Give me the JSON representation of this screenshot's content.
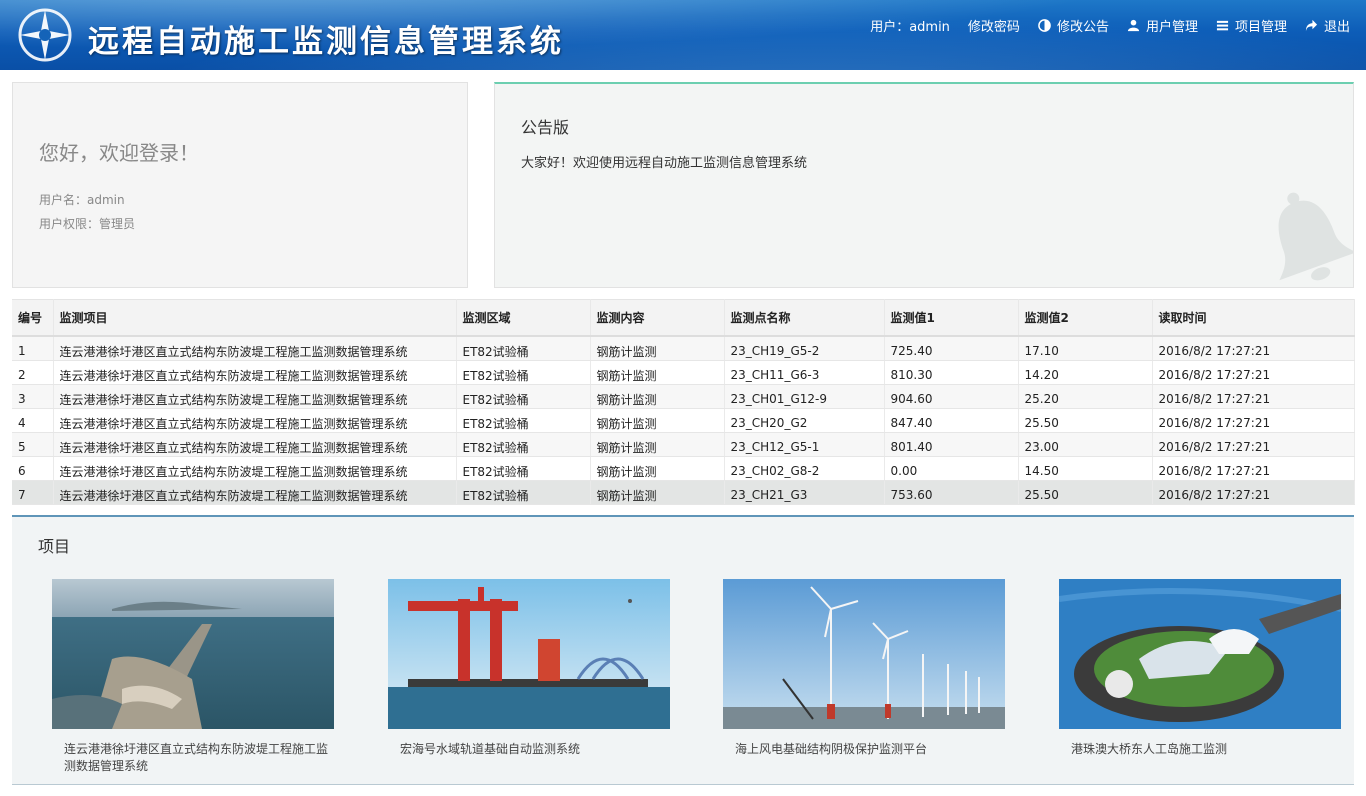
{
  "header": {
    "title": "远程自动施工监测信息管理系统",
    "nav": {
      "user": "用户：admin",
      "change_password": "修改密码",
      "edit_notice": "修改公告",
      "user_manage": "用户管理",
      "project_manage": "项目管理",
      "logout": "退出"
    }
  },
  "welcome": {
    "greeting": "您好，欢迎登录！",
    "username": "用户名：admin",
    "role": "用户权限：管理员"
  },
  "notice": {
    "title": "公告版",
    "text": "大家好！欢迎使用远程自动施工监测信息管理系统"
  },
  "table": {
    "columns": [
      "编号",
      "监测项目",
      "监测区域",
      "监测内容",
      "监测点名称",
      "监测值1",
      "监测值2",
      "读取时间"
    ],
    "rows": [
      [
        "1",
        "连云港港徐圩港区直立式结构东防波堤工程施工监测数据管理系统",
        "ET82试验桶",
        "钢筋计监测",
        "23_CH19_G5-2",
        "725.40",
        "17.10",
        "2016/8/2 17:27:21"
      ],
      [
        "2",
        "连云港港徐圩港区直立式结构东防波堤工程施工监测数据管理系统",
        "ET82试验桶",
        "钢筋计监测",
        "23_CH11_G6-3",
        "810.30",
        "14.20",
        "2016/8/2 17:27:21"
      ],
      [
        "3",
        "连云港港徐圩港区直立式结构东防波堤工程施工监测数据管理系统",
        "ET82试验桶",
        "钢筋计监测",
        "23_CH01_G12-9",
        "904.60",
        "25.20",
        "2016/8/2 17:27:21"
      ],
      [
        "4",
        "连云港港徐圩港区直立式结构东防波堤工程施工监测数据管理系统",
        "ET82试验桶",
        "钢筋计监测",
        "23_CH20_G2",
        "847.40",
        "25.50",
        "2016/8/2 17:27:21"
      ],
      [
        "5",
        "连云港港徐圩港区直立式结构东防波堤工程施工监测数据管理系统",
        "ET82试验桶",
        "钢筋计监测",
        "23_CH12_G5-1",
        "801.40",
        "23.00",
        "2016/8/2 17:27:21"
      ],
      [
        "6",
        "连云港港徐圩港区直立式结构东防波堤工程施工监测数据管理系统",
        "ET82试验桶",
        "钢筋计监测",
        "23_CH02_G8-2",
        "0.00",
        "14.50",
        "2016/8/2 17:27:21"
      ],
      [
        "7",
        "连云港港徐圩港区直立式结构东防波堤工程施工监测数据管理系统",
        "ET82试验桶",
        "钢筋计监测",
        "23_CH21_G3",
        "753.60",
        "25.50",
        "2016/8/2 17:27:21"
      ]
    ]
  },
  "projects": {
    "title": "项目",
    "items": [
      {
        "caption": "连云港港徐圩港区直立式结构东防波堤工程施工监测数据管理系统"
      },
      {
        "caption": "宏海号水域轨道基础自动监测系统"
      },
      {
        "caption": "海上风电基础结构阴极保护监测平台"
      },
      {
        "caption": "港珠澳大桥东人工岛施工监测"
      }
    ]
  }
}
